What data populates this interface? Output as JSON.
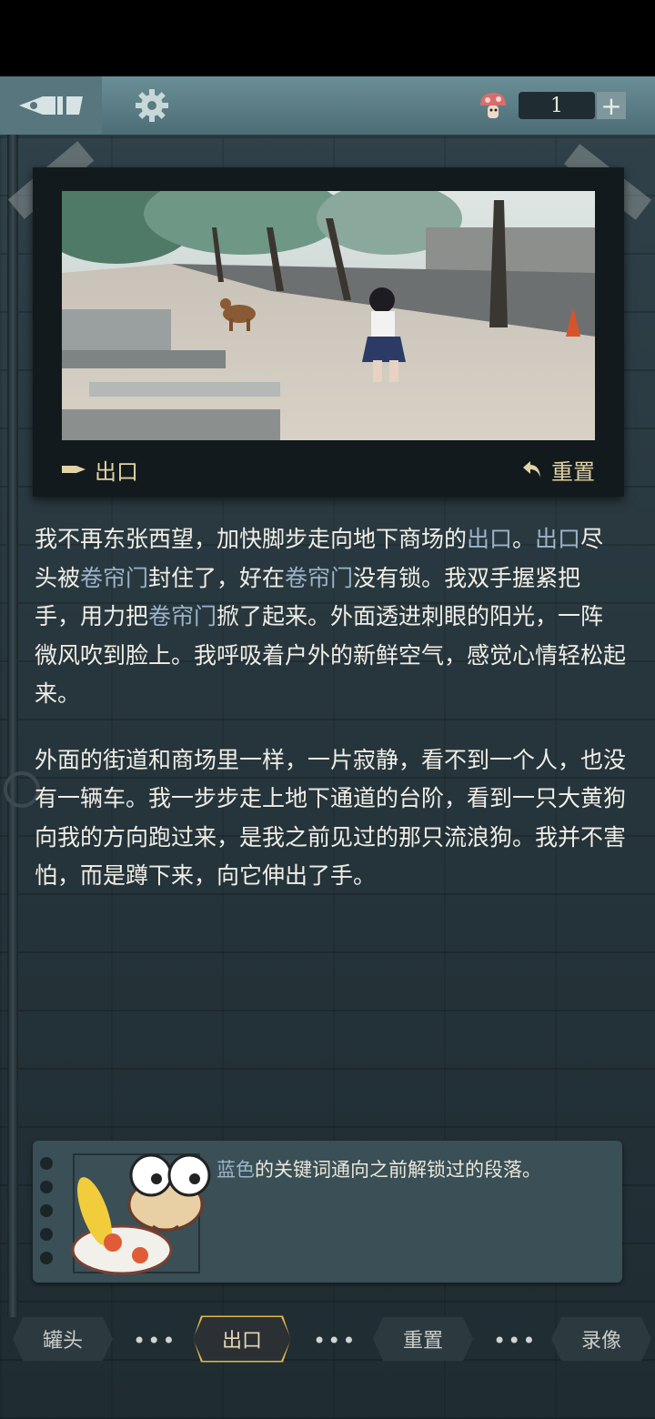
{
  "topbar": {
    "currency_count": "1",
    "plus_label": "+"
  },
  "photo_card": {
    "exit_label": "出口",
    "reset_label": "重置"
  },
  "story": {
    "paragraphs": [
      [
        {
          "t": "我不再东张西望，加快脚步走向地下商场的",
          "kw": false
        },
        {
          "t": "出口",
          "kw": true
        },
        {
          "t": "。",
          "kw": false
        },
        {
          "t": "出口",
          "kw": true
        },
        {
          "t": "尽头被",
          "kw": false
        },
        {
          "t": "卷帘门",
          "kw": true
        },
        {
          "t": "封住了，好在",
          "kw": false
        },
        {
          "t": "卷帘门",
          "kw": true
        },
        {
          "t": "没有锁。我双手握紧把手，用力把",
          "kw": false
        },
        {
          "t": "卷帘门",
          "kw": true
        },
        {
          "t": "掀了起来。外面透进刺眼的阳光，一阵微风吹到脸上。我呼吸着户外的新鲜空气，感觉心情轻松起来。",
          "kw": false
        }
      ],
      [
        {
          "t": "外面的街道和商场里一样，一片寂静，看不到一个人，也没有一辆车。我一步步走上地下通道的台阶，看到一只大黄狗向我的方向跑过来，是我之前见过的那只流浪狗。我并不害怕，而是蹲下来，向它伸出了手。",
          "kw": false
        }
      ]
    ]
  },
  "hint": {
    "keyword": "蓝色",
    "rest": "的关键词通向之前解锁过的段落。"
  },
  "bottom_nav": {
    "tabs": [
      "罐头",
      "出口",
      "重置",
      "录像"
    ],
    "active_index": 1,
    "separator": "•••"
  },
  "colors": {
    "keyword": "#9cb3c9",
    "accent_gold": "#e1b64a"
  }
}
